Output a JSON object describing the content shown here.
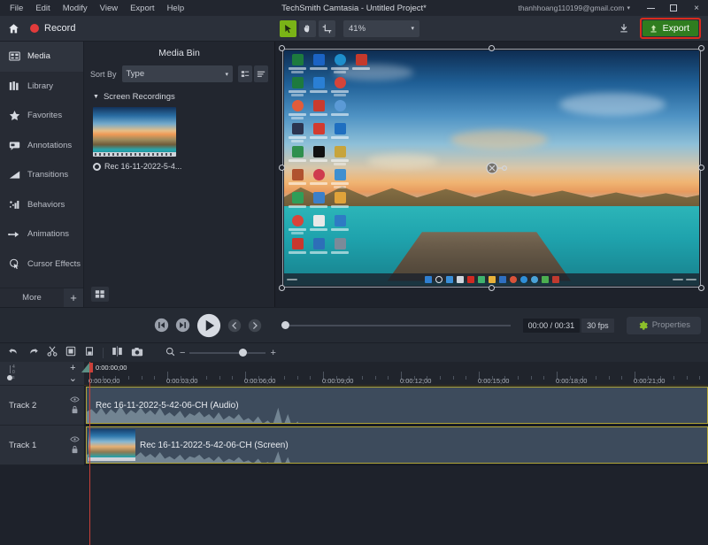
{
  "titlebar": {
    "menus": [
      "File",
      "Edit",
      "Modify",
      "View",
      "Export",
      "Help"
    ],
    "window_title": "TechSmith Camtasia - Untitled Project*",
    "account": "thanhhoang110199@gmail.com",
    "account_caret": "▾",
    "minimize": "minimize-icon",
    "maximize": "maximize-icon",
    "close": "×"
  },
  "toolbar": {
    "home_icon": "home-icon",
    "record_label": "Record",
    "tools": [
      {
        "name": "pointer-tool",
        "glyph": "pointer",
        "active": true
      },
      {
        "name": "hand-tool",
        "glyph": "hand",
        "active": false
      },
      {
        "name": "crop-tool",
        "glyph": "crop",
        "active": false
      }
    ],
    "zoom_value": "41%",
    "zoom_caret": "▾",
    "download_icon": "download-icon",
    "export_label": "Export",
    "export_icon": "export-upload-icon",
    "export_color": "#2f7d1f",
    "export_highlight_color": "#d82b1e"
  },
  "sidebar": {
    "items": [
      {
        "label": "Media",
        "icon": "film-strip-icon",
        "active": true
      },
      {
        "label": "Library",
        "icon": "library-books-icon",
        "active": false
      },
      {
        "label": "Favorites",
        "icon": "star-icon",
        "active": false
      },
      {
        "label": "Annotations",
        "icon": "callout-bubble-icon",
        "active": false
      },
      {
        "label": "Transitions",
        "icon": "transition-icon",
        "active": false
      },
      {
        "label": "Behaviors",
        "icon": "behaviors-icon",
        "active": false
      },
      {
        "label": "Animations",
        "icon": "animation-arrow-icon",
        "active": false
      },
      {
        "label": "Cursor Effects",
        "icon": "cursor-effects-icon",
        "active": false
      }
    ],
    "more_label": "More",
    "more_plus": "+"
  },
  "mediabin": {
    "title": "Media Bin",
    "sort_label": "Sort By",
    "sort_value": "Type",
    "sort_caret": "▾",
    "view_detail_icon": "list-detail-view-icon",
    "view_list_icon": "list-view-icon",
    "group_caret": "▼",
    "group_label": "Screen Recordings",
    "media_item": "Rec 16-11-2022-5-4...",
    "media_type_icon": "recording-dot-icon",
    "grid_view_icon": "grid-view-icon"
  },
  "canvas": {
    "selection": "screen-recording-clip",
    "rotate_handle": "rotate-handle-icon"
  },
  "playback": {
    "prev_frame_icon": "step-back-icon",
    "next_frame_icon": "step-forward-icon",
    "play_icon": "play-icon",
    "prev_marker_icon": "previous-marker-icon",
    "next_marker_icon": "next-marker-icon",
    "time_display": "00:00 / 00:31",
    "fps": "30 fps",
    "properties_label": "Properties",
    "properties_icon": "gear-icon"
  },
  "timeline": {
    "tools": [
      {
        "name": "undo-button",
        "icon": "undo-icon"
      },
      {
        "name": "redo-button",
        "icon": "redo-icon"
      },
      {
        "name": "cut-button",
        "icon": "scissors-icon"
      },
      {
        "name": "copy-button",
        "icon": "copy-icon"
      },
      {
        "name": "paste-button",
        "icon": "paste-icon"
      },
      {
        "name": "split-button",
        "icon": "split-icon"
      },
      {
        "name": "snapshot-button",
        "icon": "camera-icon"
      }
    ],
    "zoom_search_icon": "magnifier-icon",
    "zoom_out": "−",
    "zoom_in": "+",
    "add_track_icon": "+",
    "collapse_icon": "⌄",
    "playhead_time": "0:00:00;00",
    "ruler_labels": [
      "0:00:00;00",
      "0:00:03;00",
      "0:00:06;00",
      "0:00:09;00",
      "0:00:12;00",
      "0:00:15;00",
      "0:00:18;00",
      "0:00:21;00"
    ],
    "tracks": [
      {
        "name": "Track 2",
        "clip_label": "Rec 16-11-2022-5-42-06-CH (Audio)",
        "has_thumb": false
      },
      {
        "name": "Track 1",
        "clip_label": "Rec 16-11-2022-5-42-06-CH (Screen)",
        "has_thumb": true
      }
    ],
    "track_toggle_eye": "eye-icon",
    "track_toggle_lock": "lock-icon"
  }
}
